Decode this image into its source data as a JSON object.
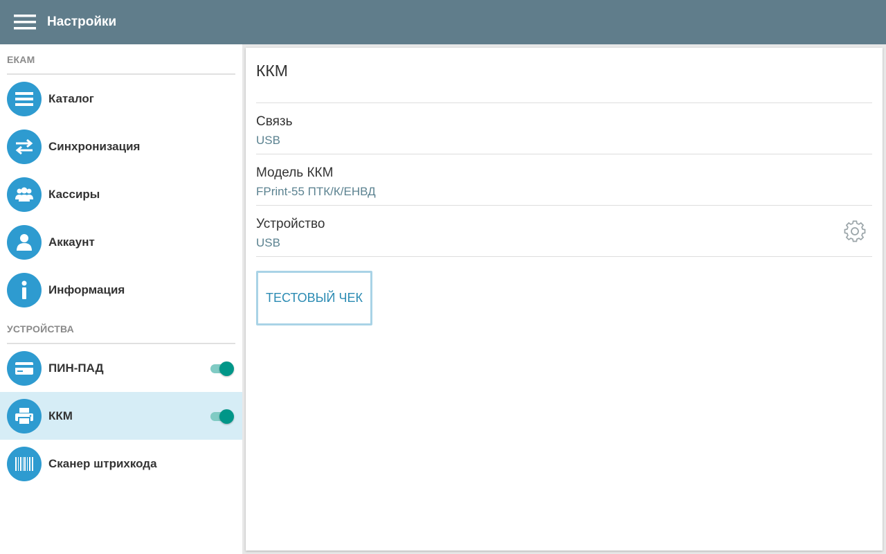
{
  "appbar": {
    "title": "Настройки",
    "menu_icon": "hamburger-menu-icon",
    "color": "#607d8b"
  },
  "sidebar": {
    "sections": [
      {
        "header": "ЕКАМ",
        "items": [
          {
            "label": "Каталог",
            "icon": "list-icon"
          },
          {
            "label": "Синхронизация",
            "icon": "sync-arrows-icon"
          },
          {
            "label": "Кассиры",
            "icon": "group-users-icon"
          },
          {
            "label": "Аккаунт",
            "icon": "user-icon"
          },
          {
            "label": "Информация",
            "icon": "info-icon"
          }
        ]
      },
      {
        "header": "УСТРОЙСТВА",
        "items": [
          {
            "label": "ПИН-ПАД",
            "icon": "credit-card-icon",
            "toggle": true
          },
          {
            "label": "ККМ",
            "icon": "printer-icon",
            "toggle": true,
            "active": true
          },
          {
            "label": "Сканер штрихкода",
            "icon": "barcode-icon"
          }
        ]
      }
    ],
    "icon_color": "#2e9bd0",
    "active_bg": "#d6edf6",
    "toggle_color": "#009688"
  },
  "panel": {
    "title": "ККМ",
    "fields": [
      {
        "label": "Связь",
        "value": "USB"
      },
      {
        "label": "Модель ККМ",
        "value": "FPrint-55 ПТК/К/ЕНВД"
      },
      {
        "label": "Устройство",
        "value": "USB",
        "action_icon": "gear-icon"
      }
    ],
    "test_button": "ТЕСТОВЫЙ ЧЕК"
  }
}
